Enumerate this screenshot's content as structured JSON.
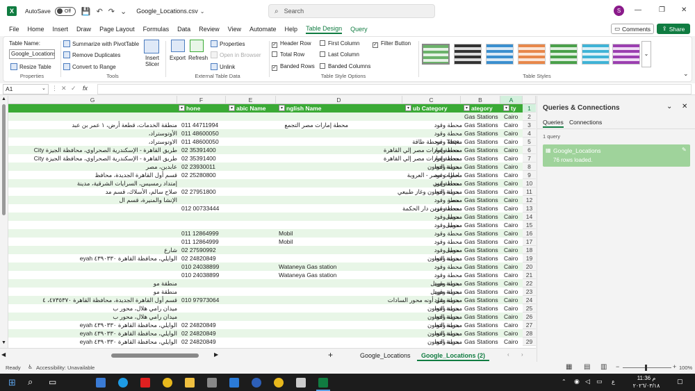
{
  "app": {
    "autosave_label": "AutoSave",
    "autosave_state": "Off",
    "filename": "Google_Locations.csv",
    "search_placeholder": "Search",
    "avatar_initial": "S"
  },
  "menu": [
    "File",
    "Home",
    "Insert",
    "Draw",
    "Page Layout",
    "Formulas",
    "Data",
    "Review",
    "View",
    "Automate",
    "Help",
    "Table Design",
    "Query"
  ],
  "menu_active": "Table Design",
  "buttons": {
    "comments": "Comments",
    "share": "Share"
  },
  "ribbon": {
    "table_name_label": "Table Name:",
    "table_name_value": "Google_Locations",
    "resize_table": "Resize Table",
    "properties_group": "Properties",
    "summarize": "Summarize with PivotTable",
    "remove_duplicates": "Remove Duplicates",
    "convert_range": "Convert to Range",
    "tools_group": "Tools",
    "insert_slicer": "Insert Slicer",
    "export": "Export",
    "refresh": "Refresh",
    "properties": "Properties",
    "open_browser": "Open in Browser",
    "unlink": "Unlink",
    "external_group": "External Table Data",
    "header_row": "Header Row",
    "total_row": "Total Row",
    "banded_rows": "Banded Rows",
    "first_column": "First Column",
    "last_column": "Last Column",
    "banded_columns": "Banded Columns",
    "filter_button": "Filter Button",
    "style_options_group": "Table Style Options",
    "styles_group": "Table Styles"
  },
  "formula": {
    "cell_ref": "A1",
    "fx": "fx"
  },
  "columns": [
    {
      "letter": "G"
    },
    {
      "letter": "F"
    },
    {
      "letter": "E"
    },
    {
      "letter": "D"
    },
    {
      "letter": "C"
    },
    {
      "letter": "B"
    },
    {
      "letter": "A"
    }
  ],
  "header": {
    "F": "hone",
    "E": "abic Name",
    "D": "nglish Name",
    "C": "ub Category",
    "B": "ategory",
    "A": "ty"
  },
  "rows": [
    {
      "n": "2",
      "G": "",
      "F": "",
      "E": "",
      "D": "",
      "C": "",
      "B": "Gas Stations",
      "A": "Cairo"
    },
    {
      "n": "3",
      "G": "منطقة الخدمات، قطعة أرض، ١ عمر بن عبد",
      "F": "011 44711994",
      "E": "",
      "D": "",
      "C": "محطة إمارات مصر التجمع",
      "B": "Gas Stations",
      "A": "Cairo",
      "C2": "محطة وقود"
    },
    {
      "n": "4",
      "G": "الأوتوستراد،",
      "F": "011 48600050",
      "E": "",
      "D": "",
      "C": "",
      "B": "Gas Stations",
      "A": "Cairo",
      "C2": "محطة وقود"
    },
    {
      "n": "5",
      "G": "الاوتوستراد،",
      "F": "011 48600050",
      "E": "",
      "D": "Taqa - محطة طاقة",
      "C": "",
      "B": "Gas Stations",
      "A": "Cairo",
      "C2": "محطة وقود"
    },
    {
      "n": "6",
      "G": "طريق القاهرة - الإسكندرية الصحراوي، محافظة الجيزة City",
      "F": "02 35391400",
      "E": "",
      "D": "محطة إمارات مصر إلي القاهرة",
      "C": "",
      "B": "Gas Stations",
      "A": "Cairo",
      "C2": "محطة وقود"
    },
    {
      "n": "7",
      "G": "طريق القاهرة - الإسكندرية الصحراوي، محافظة الجيزة City",
      "F": "02 35391400",
      "E": "",
      "D": "محطة إمارات مصر إلي القاهرة",
      "C": "",
      "B": "Gas Stations",
      "A": "Cairo",
      "C2": "محطة وقود"
    },
    {
      "n": "8",
      "G": "عابدين، مصر",
      "F": "02 23930011",
      "E": "",
      "D": "بنزينة التعاون",
      "C": "",
      "B": "Gas Stations",
      "A": "Cairo",
      "C2": "محطة وقود"
    },
    {
      "n": "9",
      "G": "قسم أول القاهرة الجديدة، محافظ",
      "F": "02 25280800",
      "E": "",
      "D": "امارات مصر - العروبة",
      "C": "",
      "B": "Gas Stations",
      "A": "Cairo",
      "C2": "محطة وقود"
    },
    {
      "n": "10",
      "G": "إمتداد رمسيس، السرايات الشرقية، مدينة",
      "F": "",
      "E": "",
      "D": "محطة إيني",
      "C": "",
      "B": "Gas Stations",
      "A": "Cairo",
      "C2": "محطة وقود"
    },
    {
      "n": "11",
      "G": "صلاح سالم، الأسلاك، قسم مد",
      "F": "02 27951800",
      "E": "",
      "D": "بنزينة التعاون وغاز طبيعي",
      "C": "",
      "B": "Gas Stations",
      "A": "Cairo",
      "C2": "محطة وقود"
    },
    {
      "n": "12",
      "G": "الإنشا والمنيرة، قسم ال",
      "F": "",
      "E": "",
      "D": "مصر",
      "C": "",
      "B": "Gas Stations",
      "A": "Cairo",
      "C2": "محطة وقود"
    },
    {
      "n": "13",
      "G": "",
      "F": "012 00733444",
      "E": "",
      "D": "محطة بنزين دار الحكمة",
      "C": "",
      "B": "Gas Stations",
      "A": "Cairo",
      "C2": "محطة وقود"
    },
    {
      "n": "14",
      "G": "",
      "F": "",
      "E": "",
      "D": "موبيل",
      "C": "",
      "B": "Gas Stations",
      "A": "Cairo",
      "C2": "محطة وقود"
    },
    {
      "n": "15",
      "G": "",
      "F": "",
      "E": "",
      "D": "موبيل",
      "C": "",
      "B": "Gas Stations",
      "A": "Cairo",
      "C2": "محطة وقود"
    },
    {
      "n": "16",
      "G": "",
      "F": "011 12864999",
      "E": "Mobil",
      "D": "",
      "C": "",
      "B": "Gas Stations",
      "A": "Cairo",
      "C2": "محطة وقود"
    },
    {
      "n": "17",
      "G": "",
      "F": "011 12864999",
      "E": "Mobil",
      "D": "",
      "C": "",
      "B": "Gas Stations",
      "A": "Cairo",
      "C2": "محطة وقود"
    },
    {
      "n": "18",
      "G": "شارع",
      "F": "02 27590992",
      "E": "",
      "D": "موبيل",
      "C": "",
      "B": "Gas Stations",
      "A": "Cairo",
      "C2": "محطة وقود"
    },
    {
      "n": "19",
      "G": "الوايلي، محافظة القاهرة ٤٣٩٠٣٣٠ eyah",
      "F": "02 24820849",
      "E": "",
      "D": "بنزينة التعاون",
      "C": "",
      "B": "Gas Stations",
      "A": "Cairo",
      "C2": "محطة وقود"
    },
    {
      "n": "20",
      "G": "",
      "F": "010 24038899",
      "E": "Wataneya Gas station",
      "D": "",
      "C": "",
      "B": "Gas Stations",
      "A": "Cairo",
      "C2": "محطة وقود"
    },
    {
      "n": "21",
      "G": "",
      "F": "010 24038899",
      "E": "Wataneya Gas station",
      "D": "",
      "C": "",
      "B": "Gas Stations",
      "A": "Cairo",
      "C2": "محطة وقود"
    },
    {
      "n": "22",
      "G": "منطقة مو",
      "F": "",
      "E": "",
      "D": "بنزينة موبيل",
      "C": "",
      "B": "Gas Stations",
      "A": "Cairo",
      "C2": "محطة وقود"
    },
    {
      "n": "23",
      "G": "منطقة مو",
      "F": "",
      "E": "",
      "D": "بنزينة موبيل",
      "C": "",
      "B": "Gas Stations",
      "A": "Cairo",
      "C2": "محطة وقود"
    },
    {
      "n": "24",
      "G": "قسم أول القاهرة الجديدة، محافظة القاهرة ٤٧٣٥٣٧٠، ٤",
      "F": "010 97973064",
      "E": "",
      "D": "بنزينة شل أونه محور السادات",
      "C": "",
      "B": "Gas Stations",
      "A": "Cairo",
      "C2": "محطة وقود"
    },
    {
      "n": "25",
      "G": "ميدان رامي هلال، محور ب",
      "F": "",
      "E": "",
      "D": "بنزينة التعاون",
      "C": "",
      "B": "Gas Stations",
      "A": "Cairo",
      "C2": "محطة وقود"
    },
    {
      "n": "26",
      "G": "ميدان رامي هلال، محور ب",
      "F": "",
      "E": "",
      "D": "بنزينة التعاون",
      "C": "",
      "B": "Gas Stations",
      "A": "Cairo",
      "C2": "محطة وقود"
    },
    {
      "n": "27",
      "G": "الوايلي، محافظة القاهرة ٤٣٩٠٣٣٠ eyah",
      "F": "02 24820849",
      "E": "",
      "D": "بنزينة التعاون",
      "C": "",
      "B": "Gas Stations",
      "A": "Cairo",
      "C2": "محطة وقود"
    },
    {
      "n": "28",
      "G": "الوايلي، محافظة القاهرة ٤٣٩٠٣٣٠ eyah",
      "F": "02 24820849",
      "E": "",
      "D": "بنزينة التعاون",
      "C": "",
      "B": "Gas Stations",
      "A": "Cairo",
      "C2": "محطة وقود"
    },
    {
      "n": "29",
      "G": "الوايلي، محافظة القاهرة ٤٣٩٠٣٣٠ eyah",
      "F": "02 24820849",
      "E": "",
      "D": "بنزينة التعاون",
      "C": "",
      "B": "Gas Stations",
      "A": "Cairo",
      "C2": "محطة وقود"
    }
  ],
  "sheets": [
    "Google_Locations",
    "Google_Locations (2)"
  ],
  "sheet_active": "Google_Locations (2)",
  "status": {
    "ready": "Ready",
    "accessibility": "Accessibility: Unavailable",
    "zoom": "100%"
  },
  "panel": {
    "title": "Queries & Connections",
    "tab_queries": "Queries",
    "tab_connections": "Connections",
    "count": "1 query",
    "query_name": "Google_Locations",
    "query_status": "76 rows loaded."
  },
  "clock": {
    "time": "11:36 م",
    "date": "٢٠٢٦/٠٣/١٨",
    "lang": "ع"
  },
  "colors": {
    "accent": "#107c41",
    "table_header": "#3aaa35",
    "band": "#e8f6e7"
  }
}
